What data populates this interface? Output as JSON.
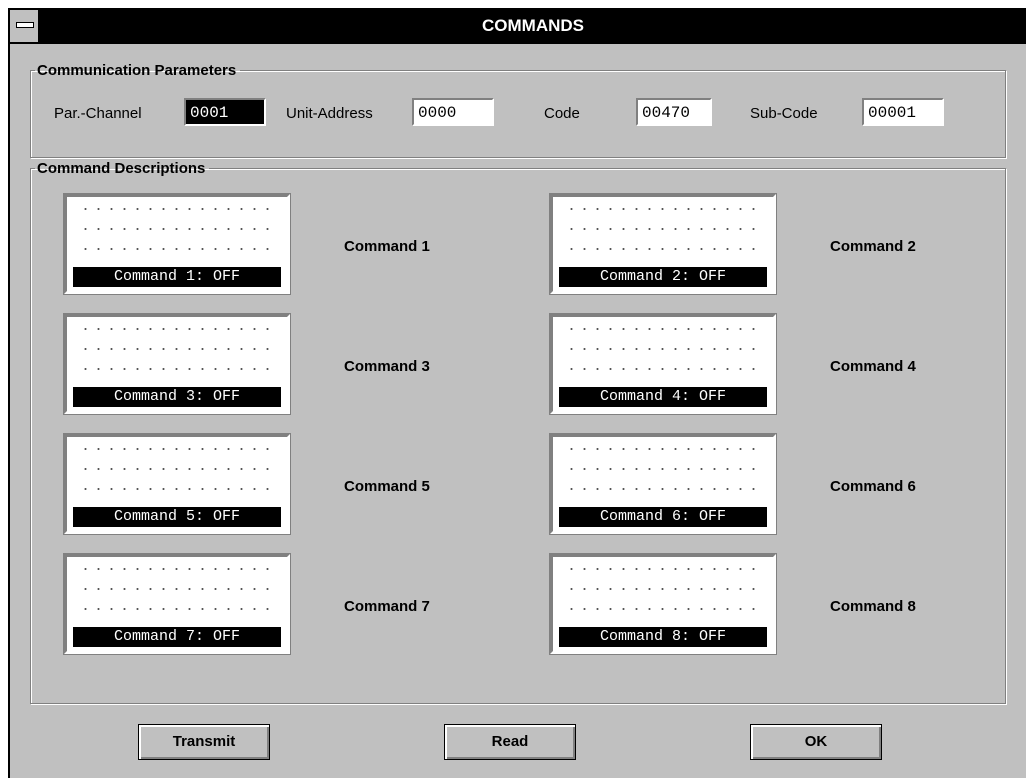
{
  "window": {
    "title": "COMMANDS"
  },
  "comm": {
    "legend": "Communication Parameters",
    "par_channel_label": "Par.-Channel",
    "par_channel_value": "0001",
    "unit_address_label": "Unit-Address",
    "unit_address_value": "0000",
    "code_label": "Code",
    "code_value": "00470",
    "subcode_label": "Sub-Code",
    "subcode_value": "00001"
  },
  "desc": {
    "legend": "Command Descriptions",
    "commands": [
      {
        "label": "Command 1",
        "status": "Command 1: OFF"
      },
      {
        "label": "Command 2",
        "status": "Command 2: OFF"
      },
      {
        "label": "Command 3",
        "status": "Command 3: OFF"
      },
      {
        "label": "Command 4",
        "status": "Command 4: OFF"
      },
      {
        "label": "Command 5",
        "status": "Command 5: OFF"
      },
      {
        "label": "Command 6",
        "status": "Command 6: OFF"
      },
      {
        "label": "Command 7",
        "status": "Command 7: OFF"
      },
      {
        "label": "Command 8",
        "status": "Command 8: OFF"
      }
    ]
  },
  "buttons": {
    "transmit": "Transmit",
    "read": "Read",
    "ok": "OK"
  }
}
